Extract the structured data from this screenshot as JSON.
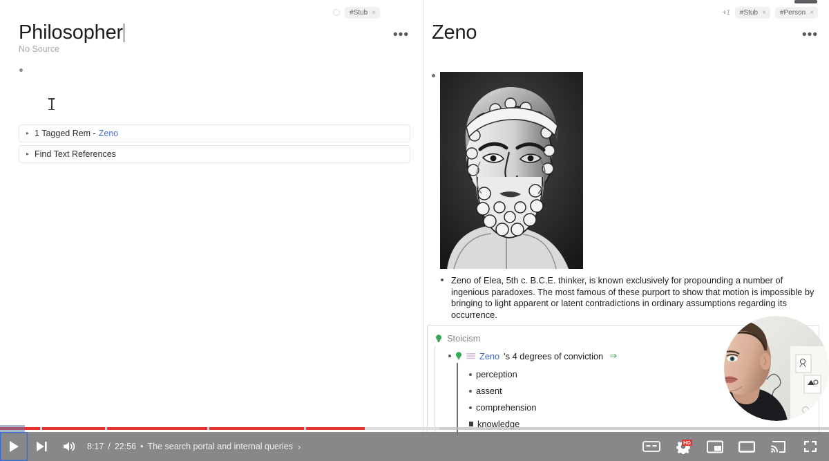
{
  "app": {
    "left_pane": {
      "tags": {
        "circle_icon": "circle-icon",
        "chips": [
          {
            "label": "#Stub",
            "close": "×"
          }
        ]
      },
      "title": "Philosopher",
      "source_label": "No Source",
      "more_menu": "•••",
      "references": [
        {
          "triangle": "▸",
          "text": "1 Tagged Rem -",
          "link": "Zeno"
        },
        {
          "triangle": "▸",
          "text": "Find Text References",
          "link": ""
        }
      ]
    },
    "right_pane": {
      "tags": {
        "plus_label": "+1",
        "chips": [
          {
            "label": "#Stub",
            "close": "×"
          },
          {
            "label": "#Person",
            "close": "×"
          }
        ]
      },
      "title": "Zeno",
      "more_menu": "•••",
      "image_alt": "zeno-engraving-portrait",
      "description": "Zeno of Elea, 5th c. B.C.E. thinker, is known exclusively for propounding a number of ingenious paradoxes. The most famous of these purport to show that motion is impossible by bringing to light apparent or latent contradictions in ordinary assumptions regarding its occurrence.",
      "stoicism_block": {
        "header": "Stoicism",
        "header_icon": "lightbulb-icon",
        "main_row": {
          "bulb_icon": "lightbulb-icon",
          "list_icon": "list-icon",
          "link": "Zeno",
          "text": "'s 4 degrees of conviction",
          "arrow": "⇒"
        },
        "items": [
          {
            "label": "perception",
            "bullet": "dot"
          },
          {
            "label": "assent",
            "bullet": "dot"
          },
          {
            "label": "comprehension",
            "bullet": "dot"
          },
          {
            "label": "knowledge",
            "bullet": "square"
          }
        ]
      }
    }
  },
  "player": {
    "current_time": "8:17",
    "separator": "/",
    "duration": "22:56",
    "chapter_dot": "•",
    "chapter_title": "The search portal and internal queries",
    "chapter_chevron": "›",
    "progress_percent": 44,
    "buffered_percent": 53,
    "accent_color": "#e5322d",
    "controls_left": [
      {
        "name": "play-button",
        "icon": "play-icon"
      },
      {
        "name": "next-button",
        "icon": "next-icon"
      },
      {
        "name": "volume-button",
        "icon": "volume-icon"
      }
    ],
    "controls_right": [
      {
        "name": "captions-button",
        "icon": "cc-icon",
        "label": "CC"
      },
      {
        "name": "settings-button",
        "icon": "gear-icon",
        "badge": "HD"
      },
      {
        "name": "miniplayer-button",
        "icon": "miniplayer-icon"
      },
      {
        "name": "theater-button",
        "icon": "theater-icon"
      },
      {
        "name": "cast-button",
        "icon": "cast-icon"
      },
      {
        "name": "fullscreen-button",
        "icon": "fullscreen-icon"
      }
    ],
    "chapter_marks": [
      58,
      152,
      300,
      440
    ]
  }
}
